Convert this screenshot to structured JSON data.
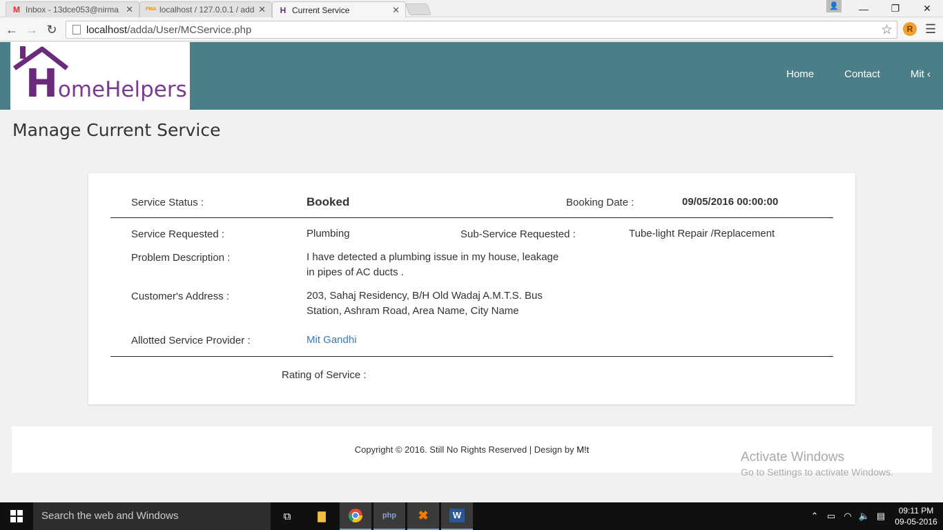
{
  "browser": {
    "tabs": [
      {
        "title": "Inbox - 13dce053@nirma",
        "favicon": "M",
        "active": false
      },
      {
        "title": "localhost / 127.0.0.1 / add",
        "favicon": "PMA",
        "active": false
      },
      {
        "title": "Current Service",
        "favicon": "H",
        "active": true
      }
    ],
    "url_host": "localhost",
    "url_path": "/adda/User/MCService.php"
  },
  "site": {
    "logo_letter": "H",
    "logo_rest": "omeHelpers",
    "nav": [
      "Home",
      "Contact",
      "Mit"
    ]
  },
  "page_title": "Manage Current Service",
  "service": {
    "status_label": "Service Status :",
    "status_value": "Booked",
    "booking_date_label": "Booking Date :",
    "booking_date_value": "09/05/2016 00:00:00",
    "requested_label": "Service Requested :",
    "requested_value": "Plumbing",
    "sub_label": "Sub-Service Requested :",
    "sub_value": "Tube-light Repair /Replacement",
    "problem_label": "Problem Description :",
    "problem_line1": "I have detected a plumbing issue in my house, leakage",
    "problem_line2": "in pipes of AC ducts .",
    "address_label": "Customer's Address :",
    "address_line1": "203, Sahaj Residency, B/H Old Wadaj A.M.T.S. Bus",
    "address_line2": "Station, Ashram Road, Area Name, City Name",
    "provider_label": "Allotted Service Provider :",
    "provider_value": "Mit Gandhi",
    "rating_label": "Rating of Service :"
  },
  "footer": {
    "copyright": "Copyright © 2016. Still No Rights Reserved | Design by ",
    "designer": "M!t"
  },
  "activate_windows": {
    "line1": "Activate Windows",
    "line2": "Go to Settings to activate Windows."
  },
  "taskbar": {
    "search_placeholder": "Search the web and Windows",
    "time": "09:11 PM",
    "date": "09-05-2016"
  },
  "colors": {
    "header_bg": "#4a7f88",
    "logo_purple": "#6a2b7a",
    "link": "#3a7ab8"
  }
}
